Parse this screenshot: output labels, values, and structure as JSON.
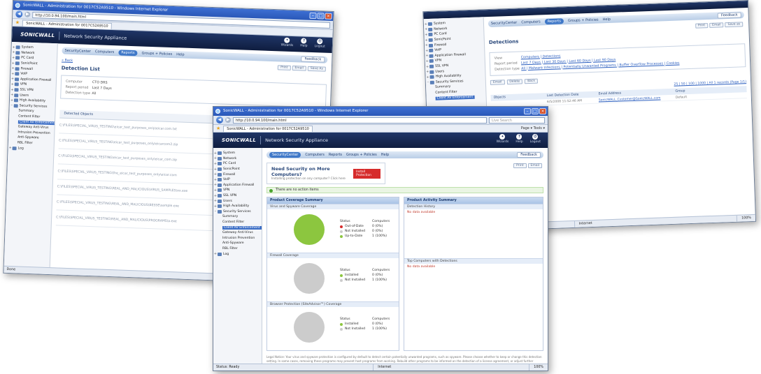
{
  "left_window": {
    "title": "SonicWALL - Administration for 0017C52A9510 - Windows Internet Explorer",
    "url": "http://10.0.94.100/main.html",
    "tab": "SonicWALL - Administration for 0017C52A9510",
    "brand": "SONICWALL",
    "product": "Network Security Appliance",
    "top_icons": [
      "Wizards",
      "Help",
      "Logout"
    ],
    "menu": [
      "SecurityCenter",
      "Computers",
      "Reports",
      "Groups + Policies",
      "Help"
    ],
    "feedback": "Feedback",
    "back": "« Back",
    "page_title": "Detection List",
    "buttons": [
      "Print",
      "Email",
      "Save As"
    ],
    "info": [
      {
        "k": "Computer",
        "v": "CTO DRS"
      },
      {
        "k": "Report period",
        "v": "Last 7 Days"
      },
      {
        "k": "Detection type",
        "v": "All"
      }
    ],
    "list_header": "Detected Objects",
    "rows": [
      "C:\\FILES\\SPECIAL_VIRUS_TESTING\\eicar_test_purposes_only\\eicar.com.txt",
      "C:\\FILES\\SPECIAL_VIRUS_TESTING\\eicar_test_purposes_only\\eicarcom2.zip",
      "C:\\FILES\\SPECIAL_VIRUS_TESTING\\eicar_test_purposes_only\\eicar_com.zip",
      "C:\\FILES\\SPECIAL_VIRUS_TESTING\\the_eicar_test_purposes_only\\eicar.com",
      "C:\\FILES\\SPECIAL_VIRUS_TESTING\\REAL_AND_MALICIOUS\\VIRUS_SAMPLES\\xx.exe",
      "C:\\FILES\\SPECIAL_VIRUS_TESTING\\REAL_AND_MALICIOUS\\BESSE\\sample.exe",
      "C:\\FILES\\SPECIAL_VIRUS_TESTING\\REAL_AND_MALICIOUS\\PROGRAMS\\a.exe"
    ],
    "status": "Done",
    "status2": "Status: Ready"
  },
  "right_window": {
    "menu": [
      "SecurityCenter",
      "Computers",
      "Reports",
      "Groups + Policies",
      "Help"
    ],
    "feedback": "Feedback",
    "page_title": "Detections",
    "buttons": [
      "Print",
      "Email",
      "Save as"
    ],
    "info": [
      {
        "k": "View",
        "v": "Computers | Detections"
      },
      {
        "k": "Report period",
        "v": "Last 7 Days | Last 30 Days | Last 60 Days | Last 90 Days"
      },
      {
        "k": "Detection type",
        "v": "All | Malware Infections | Potentially Unwanted Programs | Buffer Overflow Processes | Cookies"
      }
    ],
    "action_buttons": [
      "Email",
      "Delete",
      "Back"
    ],
    "pager": "25 | 50 | 100 | 1000 | All   1 records (Page 1/1)",
    "columns": [
      "Objects",
      "Last Detection Date",
      "Email Address",
      "Group"
    ],
    "row": [
      "",
      "6/5/2008 11:52:46 AM",
      "SonicWALL_Customer@SonicWALL.com",
      "Default"
    ],
    "zone": "Internet",
    "zoom": "100%"
  },
  "center_window": {
    "title": "SonicWALL - Administration for 0017C52A9510 - Windows Internet Explorer",
    "url": "http://10.0.94.100/main.html",
    "search_placeholder": "Live Search",
    "tab": "SonicWALL - Administration for 0017C52A9510",
    "tools": "Page ▾  Tools ▾",
    "brand": "SONICWALL",
    "product": "Network Security Appliance",
    "top_icons": [
      "Wizards",
      "Help",
      "Logout"
    ],
    "menu": [
      "SecurityCenter",
      "Computers",
      "Reports",
      "Groups + Policies",
      "Help"
    ],
    "feedback": "Feedback",
    "alert_title": "Need Security on More Computers?",
    "alert_sub": "Installing protection on any computer? Click here",
    "alert_button": "Install Protection",
    "buttons": [
      "Print",
      "Email"
    ],
    "ok_text": "There are no action items",
    "coverage_title": "Product Coverage Summary",
    "activity_title": "Product Activity Summary",
    "sections": [
      {
        "name": "Virus and Spyware Coverage",
        "rows": [
          [
            "Status",
            "Computers"
          ],
          [
            "Out-of-Date",
            "0 (0%)"
          ],
          [
            "Not Installed",
            "0 (0%)"
          ],
          [
            "Up-to-Date",
            "1 (100%)"
          ]
        ]
      },
      {
        "name": "Firewall Coverage",
        "rows": [
          [
            "Status",
            "Computers"
          ],
          [
            "Installed",
            "0 (0%)"
          ],
          [
            "Not Installed",
            "1 (100%)"
          ]
        ]
      },
      {
        "name": "Browser Protection (SiteAdvisor™) Coverage",
        "rows": [
          [
            "Status",
            "Computers"
          ],
          [
            "Installed",
            "0 (0%)"
          ],
          [
            "Not Installed",
            "1 (100%)"
          ]
        ]
      }
    ],
    "detection_history": "Detection History",
    "no_data": "No data available",
    "top_computers": "Top Computers with Detections",
    "legal": "Legal Notice: Your virus and spyware protection is configured by default to detect certain potentially unwanted programs, such as spyware. Please choose whether to keep or change this detection setting. In some cases, removing these programs may prevent host programs from working. Rebuild other programs to be informed on the detection of a license agreement, or adjust further options on your part.",
    "status": "Status: Ready",
    "zone": "Internet",
    "zoom": "100%"
  },
  "sidebar": {
    "items": [
      "System",
      "Network",
      "PC Card",
      "SonicPoint",
      "Firewall",
      "VoIP",
      "Application Firewall",
      "VPN",
      "SSL VPN",
      "Users",
      "High Availability",
      "Security Services"
    ],
    "sub_items": [
      "Summary",
      "Content Filter",
      "Client AV Enforcement",
      "Gateway Anti-Virus",
      "Intrusion Prevention",
      "Anti-Spyware",
      "RBL Filter"
    ],
    "log": "Log"
  },
  "colors": {
    "accent": "#3f78c8",
    "green": "#8cc63f",
    "grey": "#cccccc",
    "red": "#d62b2b"
  }
}
